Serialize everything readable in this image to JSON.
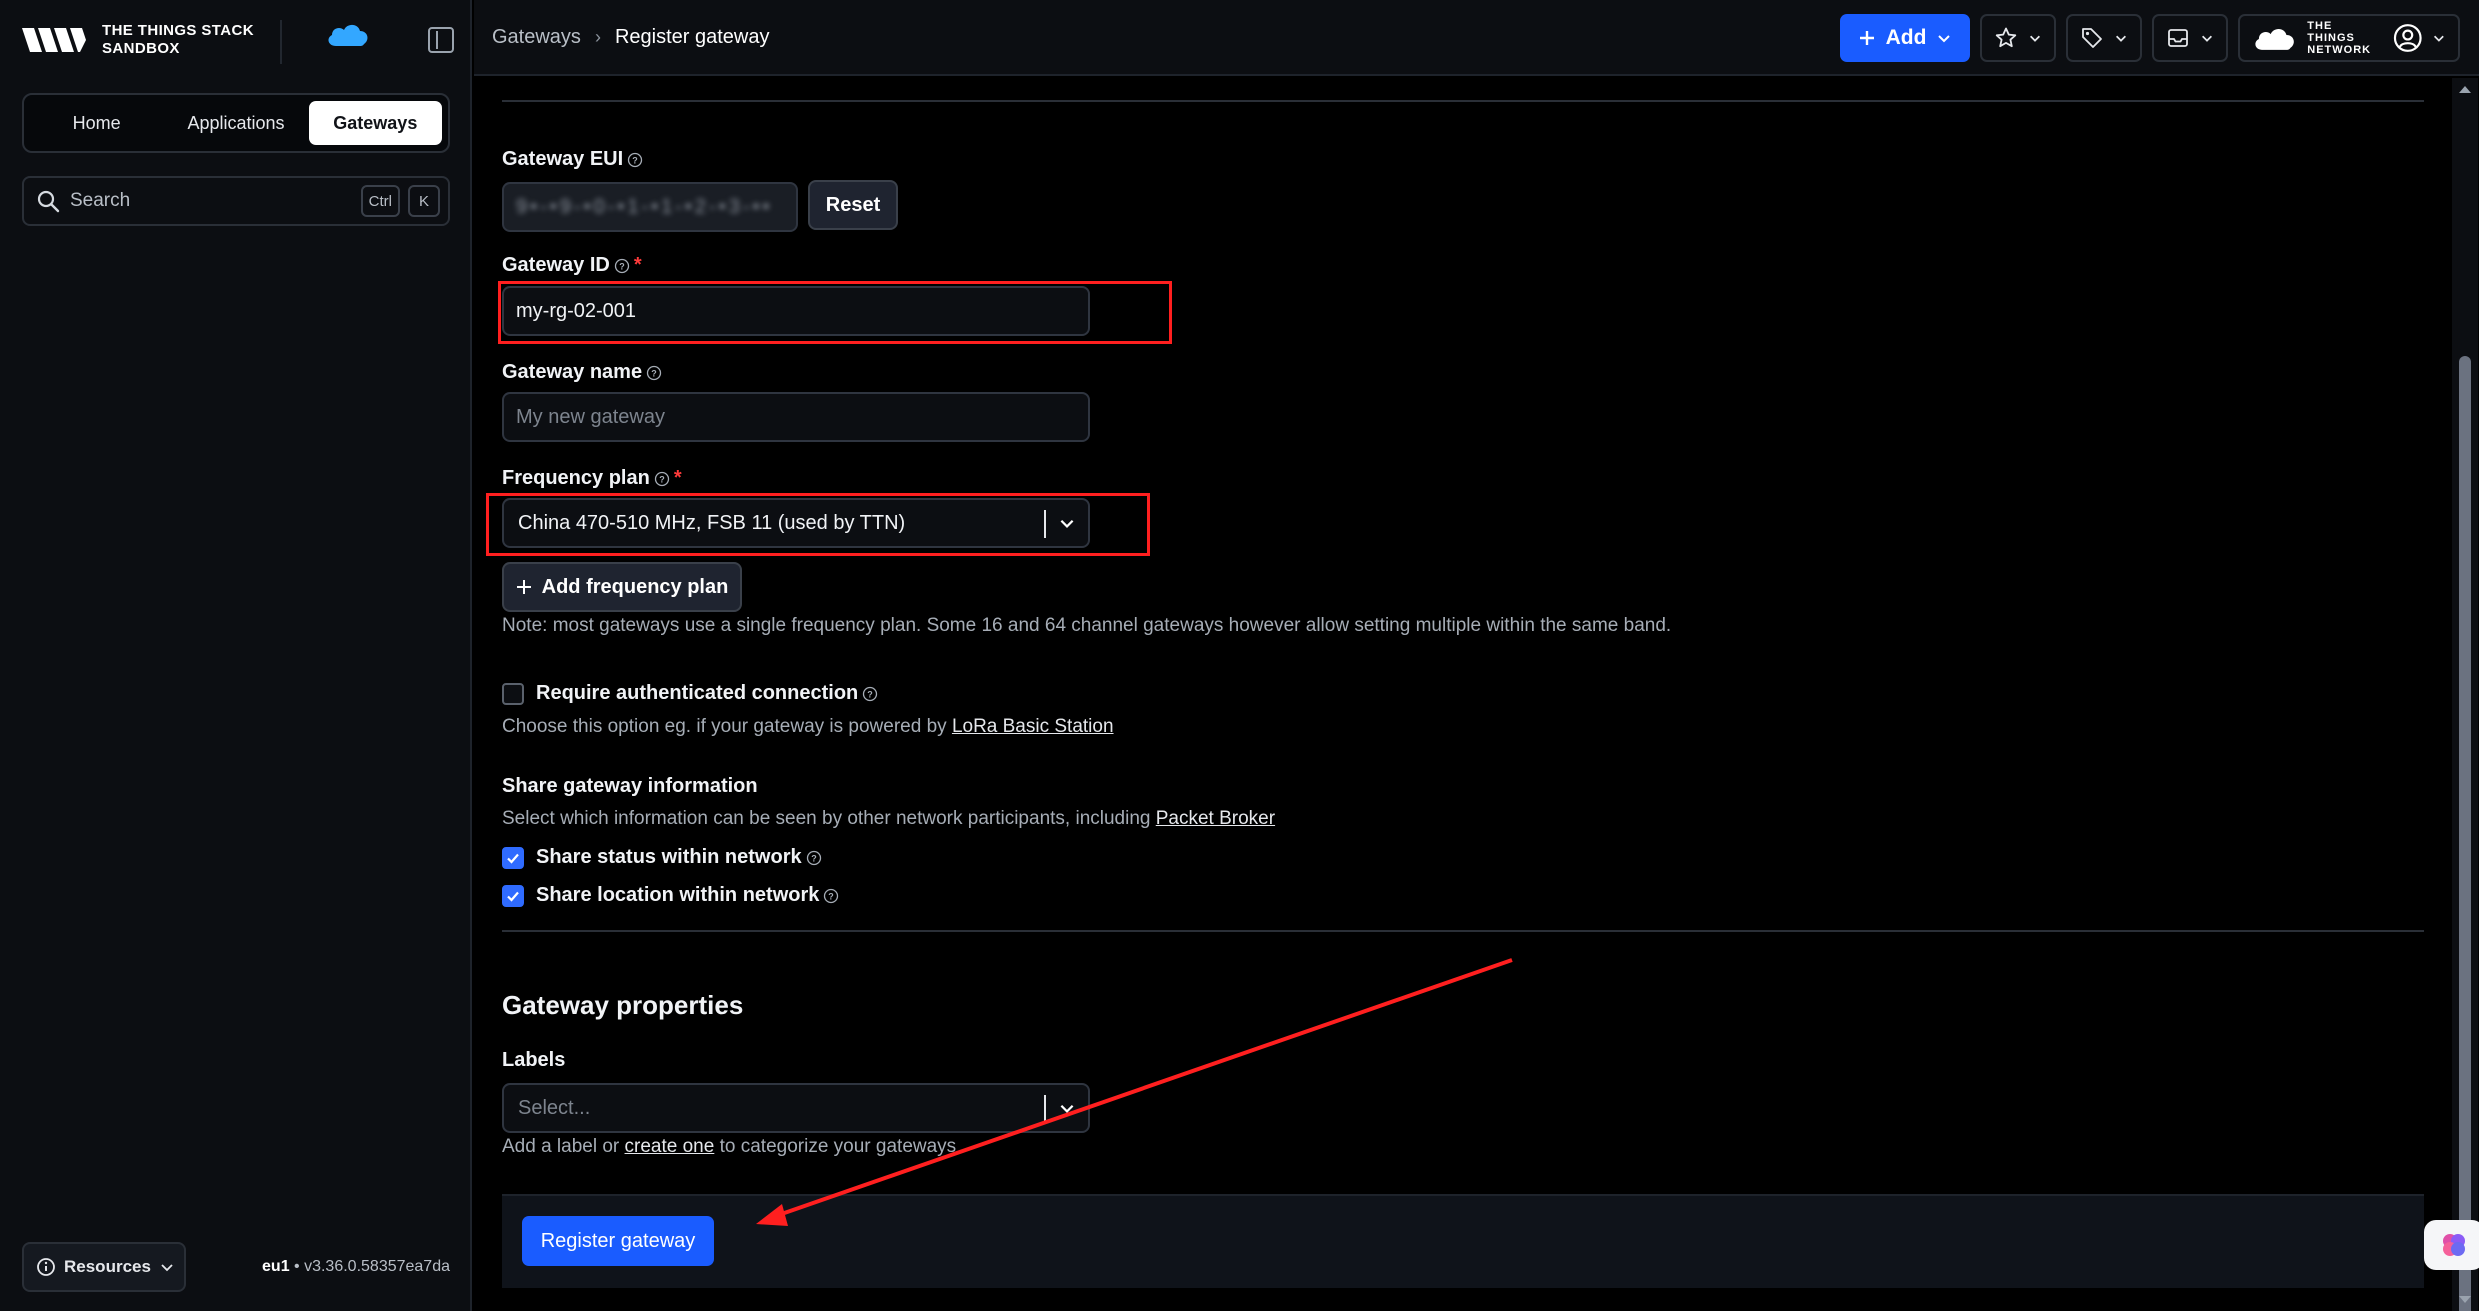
{
  "app": {
    "brand_line1": "THE THINGS STACK",
    "brand_line2": "SANDBOX"
  },
  "nav": {
    "tabs": [
      {
        "label": "Home"
      },
      {
        "label": "Applications"
      },
      {
        "label": "Gateways",
        "active": true
      }
    ]
  },
  "search": {
    "placeholder": "Search",
    "shortcut_ctrl": "Ctrl",
    "shortcut_key": "K"
  },
  "sidebar_footer": {
    "resources_label": "Resources",
    "cluster": "eu1",
    "version": " • v3.36.0.58357ea7da"
  },
  "breadcrumb": {
    "parent": "Gateways",
    "current": "Register gateway"
  },
  "topbar": {
    "add_label": "Add",
    "ttn_line1": "THE THINGS",
    "ttn_line2": "NETWORK"
  },
  "form": {
    "gateway_eui": {
      "label": "Gateway EUI",
      "value": "9•-•9-•0-•1-•1-•2-•3-••",
      "reset_label": "Reset"
    },
    "gateway_id": {
      "label": "Gateway ID",
      "required": "*",
      "value": "my-rg-02-001"
    },
    "gateway_name": {
      "label": "Gateway name",
      "placeholder": "My new gateway"
    },
    "frequency_plan": {
      "label": "Frequency plan",
      "required": "*",
      "value": "China 470-510 MHz, FSB 11 (used by TTN)",
      "add_label": "Add frequency plan",
      "note": "Note: most gateways use a single frequency plan. Some 16 and 64 channel gateways however allow setting multiple within the same band."
    },
    "auth_connection": {
      "label": "Require authenticated connection",
      "checked": false,
      "hint_prefix": "Choose this option eg. if your gateway is powered by ",
      "hint_link": "LoRa Basic Station"
    },
    "share": {
      "heading": "Share gateway information",
      "hint_prefix": "Select which information can be seen by other network participants, including ",
      "hint_link": "Packet Broker",
      "status_label": "Share status within network",
      "status_checked": true,
      "location_label": "Share location within network",
      "location_checked": true
    },
    "properties": {
      "title": "Gateway properties",
      "labels_label": "Labels",
      "labels_placeholder": "Select...",
      "hint_prefix": "Add a label or ",
      "hint_link": "create one",
      "hint_suffix": " to categorize your gateways"
    },
    "submit_label": "Register gateway"
  },
  "colors": {
    "accent": "#1a5cff",
    "annotation": "#ff1f1f",
    "background": "#000000"
  }
}
